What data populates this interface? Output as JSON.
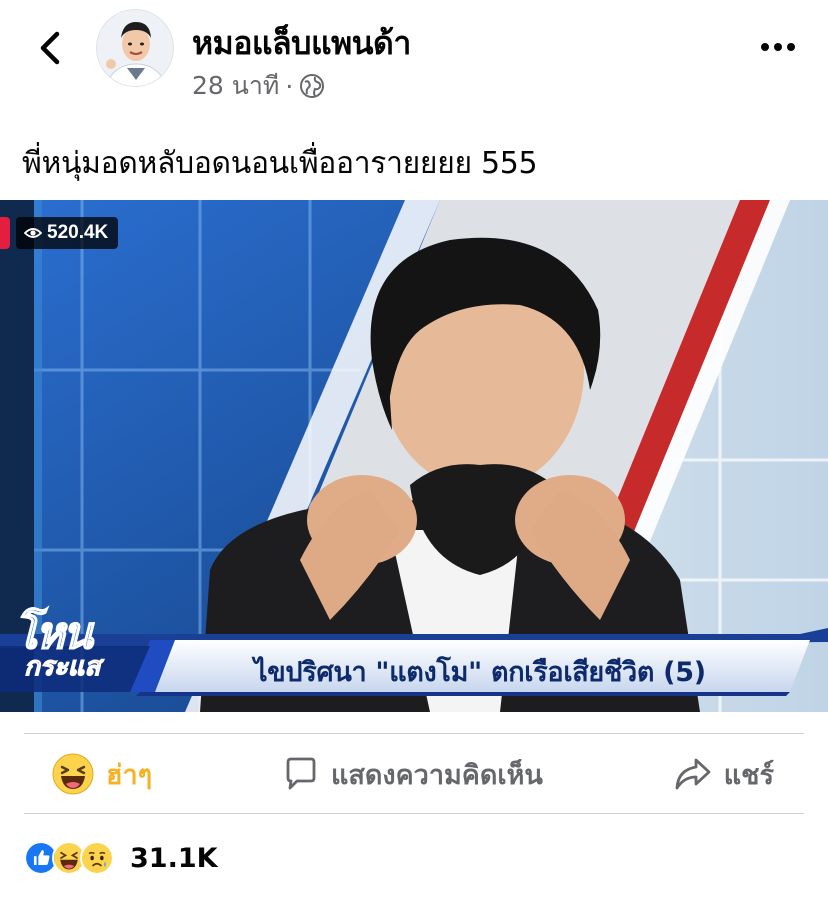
{
  "post": {
    "author": "หมอแล็บแพนด้า",
    "time": "28 นาที",
    "separator": "·",
    "audience_icon": "globe-icon",
    "caption": "พี่หนุ่มอดหลับอดนอนเพื่ออารายยยย 555"
  },
  "video": {
    "view_count": "520.4K",
    "show_logo_line1": "โหน",
    "show_logo_line2": "กระแส",
    "ticker": "ไขปริศนา \"แตงโม\" ตกเรือเสียชีวิต (5)"
  },
  "actions": {
    "reaction_label": "ฮ่าๆ",
    "comment_label": "แสดงความคิดเห็น",
    "share_label": "แชร์"
  },
  "summary": {
    "reaction_count": "31.1K",
    "reaction_icons": [
      "like-icon",
      "haha-icon",
      "sad-icon"
    ]
  },
  "colors": {
    "haha": "#f7b125",
    "secondary_text": "#65676b",
    "like_blue": "#1877f2"
  }
}
